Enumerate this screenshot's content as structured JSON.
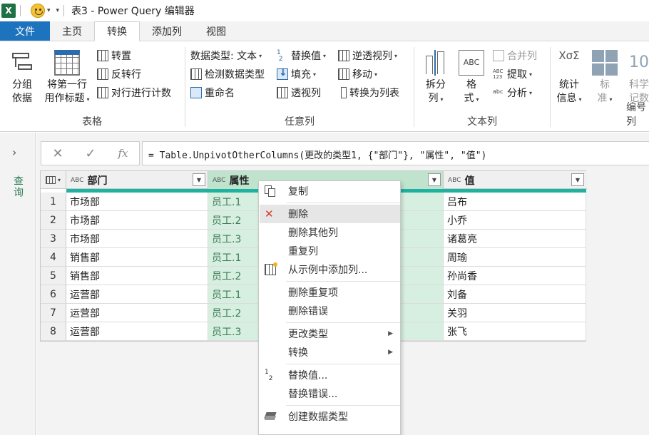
{
  "window": {
    "app_logo": "X",
    "title": "表3 - Power Query 编辑器"
  },
  "menu": {
    "tabs": [
      "文件",
      "主页",
      "转换",
      "添加列",
      "视图"
    ],
    "active": "转换"
  },
  "ribbon": {
    "table_group": {
      "label": "表格",
      "group_by": [
        "分组",
        "依据"
      ],
      "first_row_header": [
        "将第一行",
        "用作标题"
      ],
      "transpose": "转置",
      "reverse_rows": "反转行",
      "count_rows": "对行进行计数"
    },
    "any_column_group": {
      "label": "任意列",
      "data_type": "数据类型: 文本",
      "detect_type": "检测数据类型",
      "rename": "重命名",
      "replace_values": "替换值",
      "fill": "填充",
      "pivot": "透视列",
      "unpivot": "逆透视列",
      "move": "移动",
      "to_list": "转换为列表"
    },
    "text_column_group": {
      "label": "文本列",
      "split": [
        "拆分",
        "列"
      ],
      "format": [
        "格",
        "式"
      ],
      "merge": "合并列",
      "extract": "提取",
      "parse": "分析",
      "abc_glyph": "ABC",
      "abc123_glyph": "ABC\n123",
      "abc_small_glyph": "abc"
    },
    "number_column_group": {
      "label": "编号列",
      "statistics": [
        "统计",
        "信息"
      ],
      "standard": [
        "标",
        "准"
      ],
      "scientific": [
        "科学",
        "记数"
      ],
      "sigma_glyph": "XσΣ",
      "ten_glyph": "10"
    }
  },
  "formula_bar": {
    "cancel": "✕",
    "confirm": "✓",
    "fx": "fx",
    "text": "= Table.UnpivotOtherColumns(更改的类型1, {\"部门\"}, \"属性\", \"值\")"
  },
  "side_pane": {
    "expand": "›",
    "queries_label": "查询"
  },
  "grid": {
    "type_glyph": "ABC",
    "columns": [
      "部门",
      "属性",
      "值"
    ],
    "rows": [
      {
        "n": "1",
        "dept": "市场部",
        "attr": "员工.1",
        "val": "吕布"
      },
      {
        "n": "2",
        "dept": "市场部",
        "attr": "员工.2",
        "val": "小乔"
      },
      {
        "n": "3",
        "dept": "市场部",
        "attr": "员工.3",
        "val": "诸葛亮"
      },
      {
        "n": "4",
        "dept": "销售部",
        "attr": "员工.1",
        "val": "周瑜"
      },
      {
        "n": "5",
        "dept": "销售部",
        "attr": "员工.2",
        "val": "孙尚香"
      },
      {
        "n": "6",
        "dept": "运营部",
        "attr": "员工.1",
        "val": "刘备"
      },
      {
        "n": "7",
        "dept": "运营部",
        "attr": "员工.2",
        "val": "关羽"
      },
      {
        "n": "8",
        "dept": "运营部",
        "attr": "员工.3",
        "val": "张飞"
      }
    ]
  },
  "context_menu": {
    "items": [
      "复制",
      "删除",
      "删除其他列",
      "重复列",
      "从示例中添加列...",
      "删除重复项",
      "删除错误",
      "更改类型",
      "转换",
      "替换值...",
      "替换错误...",
      "创建数据类型"
    ],
    "replace_glyph": "1→2"
  },
  "colors": {
    "file_tab": "#1e73be",
    "selected_column": "#bfe3cd",
    "header_strip": "#20b2a0",
    "queries_label": "#2e7d55"
  }
}
